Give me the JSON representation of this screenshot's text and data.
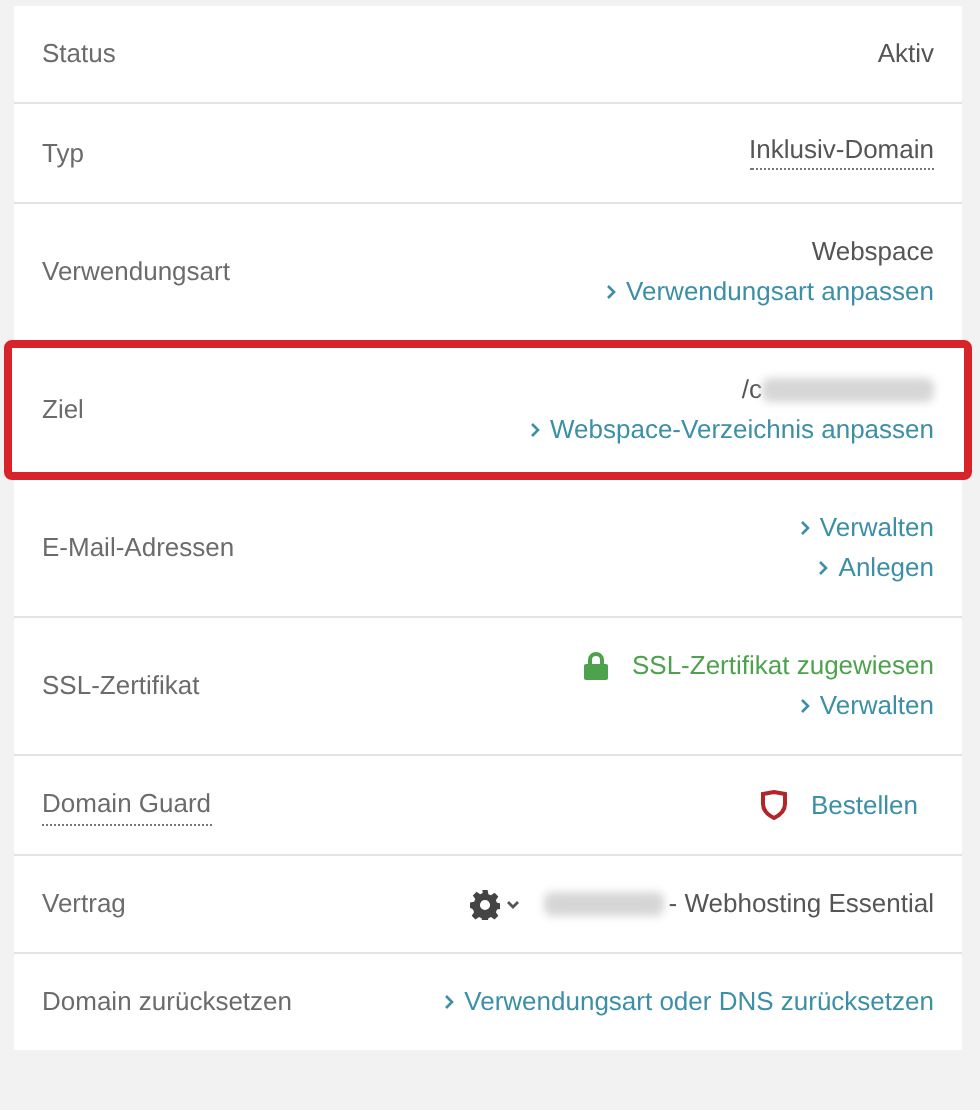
{
  "rows": [
    {
      "label": "Status",
      "label_dotted": false,
      "highlighted": false,
      "lines": [
        {
          "kind": "text",
          "text": "Aktiv"
        }
      ]
    },
    {
      "label": "Typ",
      "label_dotted": false,
      "highlighted": false,
      "lines": [
        {
          "kind": "dotted",
          "text": "Inklusiv-Domain"
        }
      ]
    },
    {
      "label": "Verwendungsart",
      "label_dotted": false,
      "highlighted": false,
      "lines": [
        {
          "kind": "text",
          "text": "Webspace"
        },
        {
          "kind": "link",
          "text": "Verwendungsart anpassen"
        }
      ]
    },
    {
      "label": "Ziel",
      "label_dotted": false,
      "highlighted": true,
      "lines": [
        {
          "kind": "redacted",
          "text": "/c"
        },
        {
          "kind": "link",
          "text": "Webspace-Verzeichnis anpassen"
        }
      ]
    },
    {
      "label": "E-Mail-Adressen",
      "label_dotted": false,
      "highlighted": false,
      "lines": [
        {
          "kind": "link",
          "text": "Verwalten"
        },
        {
          "kind": "link",
          "text": "Anlegen"
        }
      ]
    },
    {
      "label": "SSL-Zertifikat",
      "label_dotted": false,
      "highlighted": false,
      "lines": [
        {
          "kind": "secure",
          "text": "SSL-Zertifikat zugewiesen"
        },
        {
          "kind": "link",
          "text": "Verwalten"
        }
      ]
    },
    {
      "label": "Domain Guard",
      "label_dotted": true,
      "highlighted": false,
      "lines": [
        {
          "kind": "order",
          "text": "Bestellen"
        }
      ]
    },
    {
      "label": "Vertrag",
      "label_dotted": false,
      "highlighted": false,
      "lines": [
        {
          "kind": "contract",
          "text": "- Webhosting Essential"
        }
      ]
    },
    {
      "label": "Domain zurücksetzen",
      "label_dotted": false,
      "highlighted": false,
      "lines": [
        {
          "kind": "link",
          "text": "Verwendungsart oder DNS zurücksetzen"
        }
      ]
    }
  ]
}
